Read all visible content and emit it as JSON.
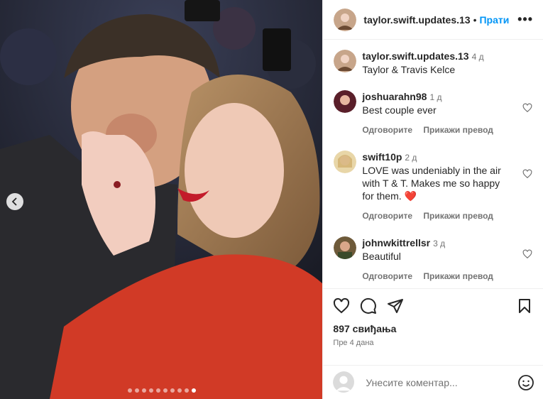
{
  "post": {
    "username": "taylor.swift.updates.13",
    "follow_label": "Прати",
    "more_label": "•••",
    "caption": {
      "username": "taylor.swift.updates.13",
      "time": "4 д",
      "text": "Taylor & Travis Kelce"
    },
    "comments": [
      {
        "username": "joshuarahn98",
        "time": "1 д",
        "text": "Best couple ever",
        "reply_label": "Одговорите",
        "translate_label": "Прикажи превод"
      },
      {
        "username": "swift10p",
        "time": "2 д",
        "text": "LOVE was undeniably in the air with T & T. Makes me so happy for them. ❤️",
        "reply_label": "Одговорите",
        "translate_label": "Прикажи превод"
      },
      {
        "username": "johnwkittrellsr",
        "time": "3 д",
        "text": "Beautiful",
        "reply_label": "Одговорите",
        "translate_label": "Прикажи превод"
      }
    ],
    "likes": "897 свиђања",
    "posted_ago": "Пре 4 дана",
    "comment_placeholder": "Унесите коментар...",
    "carousel": {
      "total": 10,
      "active_index": 9
    }
  },
  "icons": {
    "like": "heart-icon",
    "comment": "comment-bubble-icon",
    "share": "paper-plane-icon",
    "save": "bookmark-icon",
    "emoji": "emoji-icon",
    "prev": "chevron-left-icon",
    "more": "more-options-icon"
  },
  "colors": {
    "accent": "#0095f6",
    "heart_red": "#ed4956",
    "text": "#262626",
    "secondary": "#737373"
  }
}
